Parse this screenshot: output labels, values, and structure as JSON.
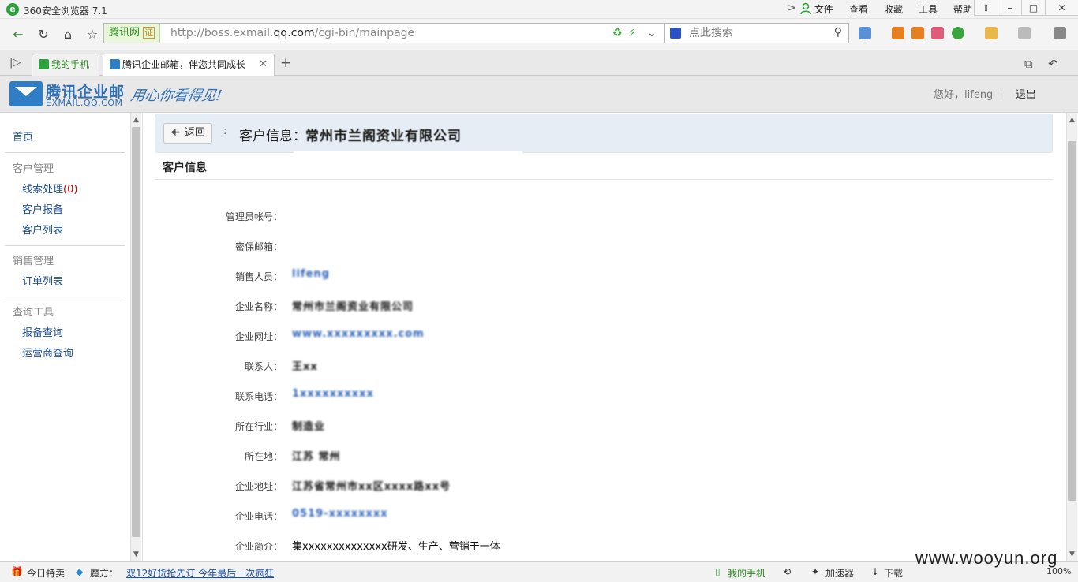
{
  "browser": {
    "title": "360安全浏览器 7.1",
    "menu": [
      "文件",
      "查看",
      "收藏",
      "工具",
      "帮助"
    ],
    "url_prefix": "http://boss.exmail.",
    "url_domain": "qq.com",
    "url_path": "/cgi-bin/mainpage",
    "cert_label": "腾讯网",
    "cert_badge": "证",
    "search_placeholder": "点此搜索",
    "tabs": [
      {
        "label": "我的手机"
      },
      {
        "label": "腾讯企业邮箱，伴您共同成长"
      }
    ]
  },
  "header": {
    "brand_name": "腾讯企业邮",
    "brand_sub": "EXMAIL.QQ.COM",
    "slogan": "用心你看得见!",
    "greeting": "您好，",
    "username": "lifeng",
    "logout": "退出"
  },
  "sidebar": {
    "home": "首页",
    "groups": [
      {
        "title": "客户管理",
        "items": [
          {
            "label": "线索处理",
            "count": "(0)"
          },
          {
            "label": "客户报备"
          },
          {
            "label": "客户列表"
          }
        ]
      },
      {
        "title": "销售管理",
        "items": [
          {
            "label": "订单列表"
          }
        ]
      },
      {
        "title": "查询工具",
        "items": [
          {
            "label": "报备查询"
          },
          {
            "label": "运营商查询"
          }
        ]
      }
    ]
  },
  "main": {
    "back_label": "返回",
    "crumb_title": "客户信息",
    "crumb_sep": "：",
    "crumb_value": "常州市兰阁资业有限公司",
    "section_title": "客户信息",
    "fields": [
      {
        "label": "管理员帐号：",
        "value": ""
      },
      {
        "label": "密保邮箱：",
        "value": ""
      },
      {
        "label": "销售人员：",
        "value": "lifeng"
      },
      {
        "label": "企业名称：",
        "value": "常州市兰阁资业有限公司"
      },
      {
        "label": "企业网址：",
        "value": "www.xxxxxxxxx.com"
      },
      {
        "label": "联系人：",
        "value": "王xx"
      },
      {
        "label": "联系电话：",
        "value": "1xxxxxxxxxx"
      },
      {
        "label": "所在行业：",
        "value": "制造业"
      },
      {
        "label": "所在地：",
        "value": "江苏 常州"
      },
      {
        "label": "企业地址：",
        "value": "江苏省常州市xx区xxxx路xx号"
      },
      {
        "label": "企业电话：",
        "value": "0519-xxxxxxxx"
      },
      {
        "label": "企业简介：",
        "value": "集xxxxxxxxxxxxxx研发、生产、营销于一体"
      }
    ]
  },
  "statusbar": {
    "deals": "今日特卖",
    "magic": "魔方：",
    "promo": "双12好货抢先订  今年最后一次疯狂",
    "phone": "我的手机",
    "accel": "加速器",
    "download": "下载",
    "zoom": "100%"
  },
  "watermark": "www.wooyun.org"
}
